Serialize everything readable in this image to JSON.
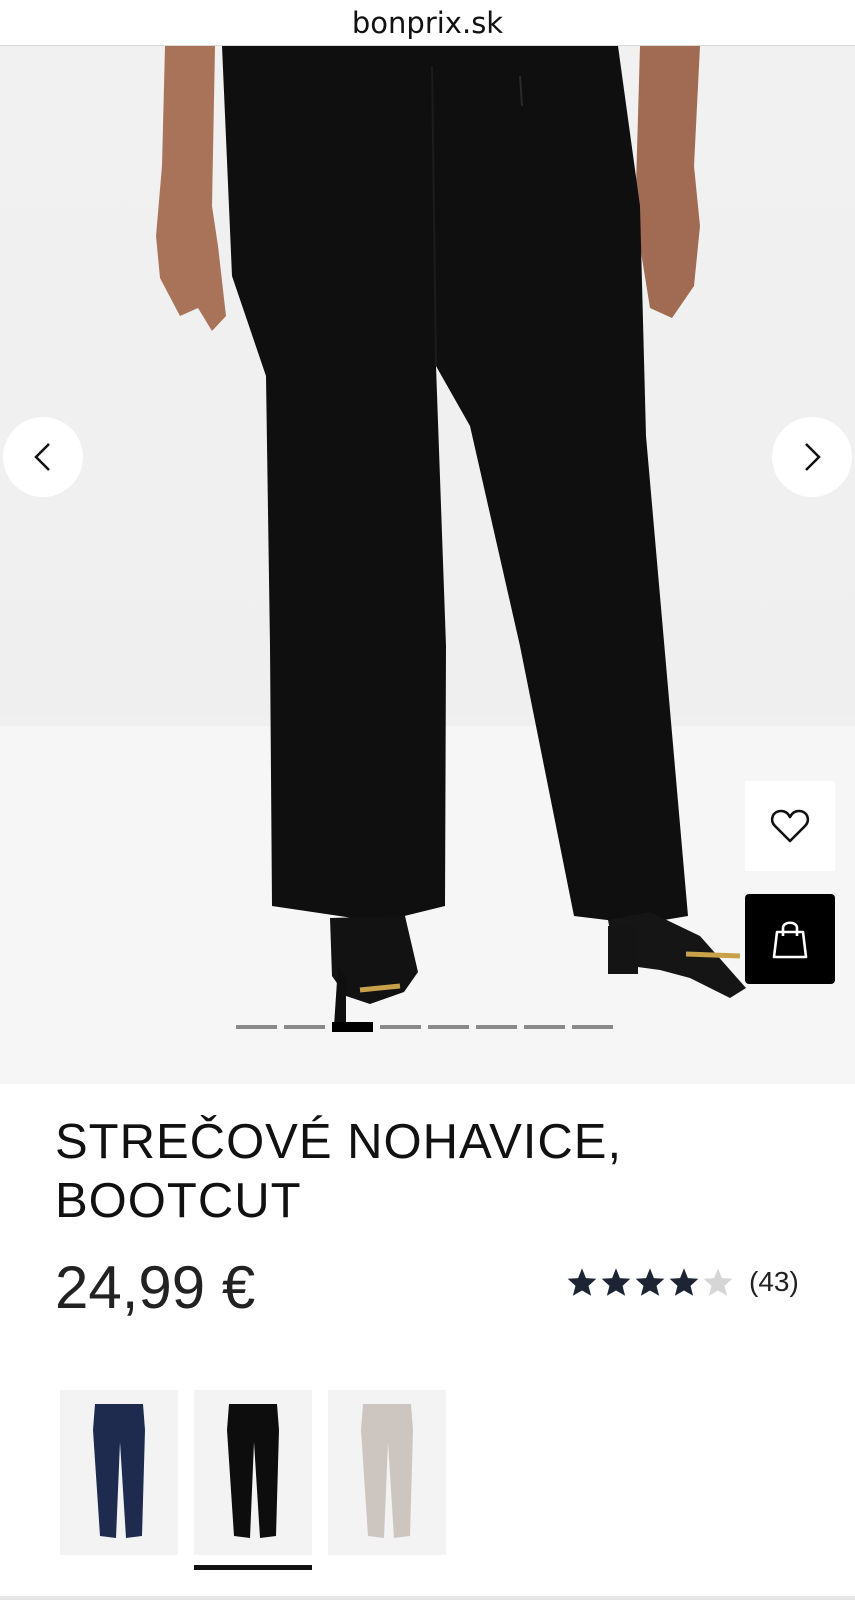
{
  "browser": {
    "url": "bonprix.sk"
  },
  "gallery": {
    "image_alt": "black bootcut pants worn by model",
    "prev_icon": "chevron-left-icon",
    "next_icon": "chevron-right-icon",
    "wishlist_icon": "heart-icon",
    "cart_icon": "shopping-bag-icon",
    "slide_count": 8,
    "active_slide": 3
  },
  "product": {
    "title_line1": "STREČOVÉ NOHAVICE,",
    "title_line2": "BOOTCUT",
    "price": "24,99 €",
    "rating": {
      "value": 4,
      "max": 5,
      "count_label": "(43)"
    }
  },
  "swatches": [
    {
      "name": "navy",
      "color": "#1e2b4e",
      "selected": false
    },
    {
      "name": "black",
      "color": "#0d0d0d",
      "selected": true
    },
    {
      "name": "beige",
      "color": "#cdc5bf",
      "selected": false
    }
  ],
  "colors": {
    "star_filled": "#1d2433",
    "star_empty": "#d6d6d6",
    "accent": "#000000"
  }
}
